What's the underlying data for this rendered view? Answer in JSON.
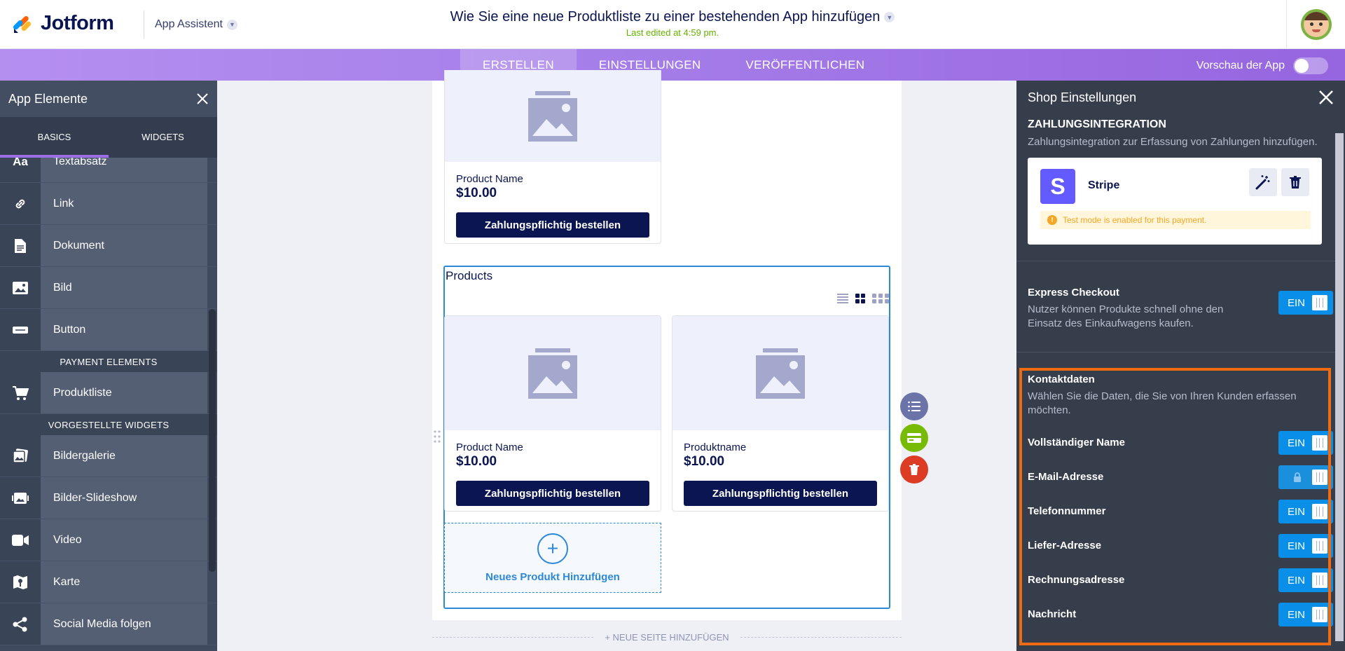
{
  "header": {
    "logo_text": "Jotform",
    "app_assistant": "App Assistent",
    "title": "Wie Sie eine neue Produktliste zu einer bestehenden App hinzufügen",
    "last_edited": "Last edited at 4:59 pm."
  },
  "nav": {
    "tabs": [
      "ERSTELLEN",
      "EINSTELLUNGEN",
      "VERÖFFENTLICHEN"
    ],
    "active_tab": "ERSTELLEN",
    "preview_label": "Vorschau der App"
  },
  "left_panel": {
    "title": "App Elemente",
    "tabs": [
      "BASICS",
      "WIDGETS"
    ],
    "items": [
      {
        "label": "Textabsatz",
        "icon": "text-icon"
      },
      {
        "label": "Link",
        "icon": "link-icon"
      },
      {
        "label": "Dokument",
        "icon": "document-icon"
      },
      {
        "label": "Bild",
        "icon": "image-icon"
      },
      {
        "label": "Button",
        "icon": "button-icon"
      }
    ],
    "section_payment": "PAYMENT ELEMENTS",
    "payment_items": [
      {
        "label": "Produktliste",
        "icon": "cart-icon"
      }
    ],
    "section_widgets": "VORGESTELLTE WIDGETS",
    "widget_items": [
      {
        "label": "Bildergalerie",
        "icon": "gallery-icon"
      },
      {
        "label": "Bilder-Slideshow",
        "icon": "slideshow-icon"
      },
      {
        "label": "Video",
        "icon": "video-icon"
      },
      {
        "label": "Karte",
        "icon": "map-icon"
      },
      {
        "label": "Social Media folgen",
        "icon": "share-icon"
      }
    ]
  },
  "canvas": {
    "top_card": {
      "name": "Product Name",
      "price": "$10.00",
      "button": "Zahlungspflichtig bestellen"
    },
    "products_title": "Products",
    "cards": [
      {
        "name": "Product Name",
        "price": "$10.00",
        "button": "Zahlungspflichtig bestellen"
      },
      {
        "name": "Produktname",
        "price": "$10.00",
        "button": "Zahlungspflichtig bestellen"
      }
    ],
    "add_product": "Neues Produkt Hinzufügen",
    "add_page": "+ NEUE SEITE HINZUFÜGEN"
  },
  "right_panel": {
    "title": "Shop Einstellungen",
    "payment": {
      "title": "ZAHLUNGSINTEGRATION",
      "desc": "Zahlungsintegration zur Erfassung von Zahlungen hinzufügen.",
      "provider": "Stripe",
      "provider_letter": "S",
      "warning": "Test mode is enabled for this payment."
    },
    "express": {
      "title": "Express Checkout",
      "desc": "Nutzer können Produkte schnell ohne den Einsatz des Einkaufwagens kaufen.",
      "toggle": "EIN"
    },
    "contact": {
      "title": "Kontaktdaten",
      "desc": "Wählen Sie die Daten, die Sie von Ihren Kunden erfassen möchten.",
      "fields": [
        {
          "label": "Vollständiger Name",
          "toggle": "EIN",
          "locked": false
        },
        {
          "label": "E-Mail-Adresse",
          "toggle": "",
          "locked": true
        },
        {
          "label": "Telefonnummer",
          "toggle": "EIN",
          "locked": false
        },
        {
          "label": "Liefer-Adresse",
          "toggle": "EIN",
          "locked": false
        },
        {
          "label": "Rechnungsadresse",
          "toggle": "EIN",
          "locked": false
        },
        {
          "label": "Nachricht",
          "toggle": "EIN",
          "locked": false
        }
      ]
    }
  },
  "colors": {
    "accent": "#9d6ee6",
    "toggle_on": "#0a8fe8",
    "highlight": "#ee6a13",
    "navy": "#0a1551"
  }
}
